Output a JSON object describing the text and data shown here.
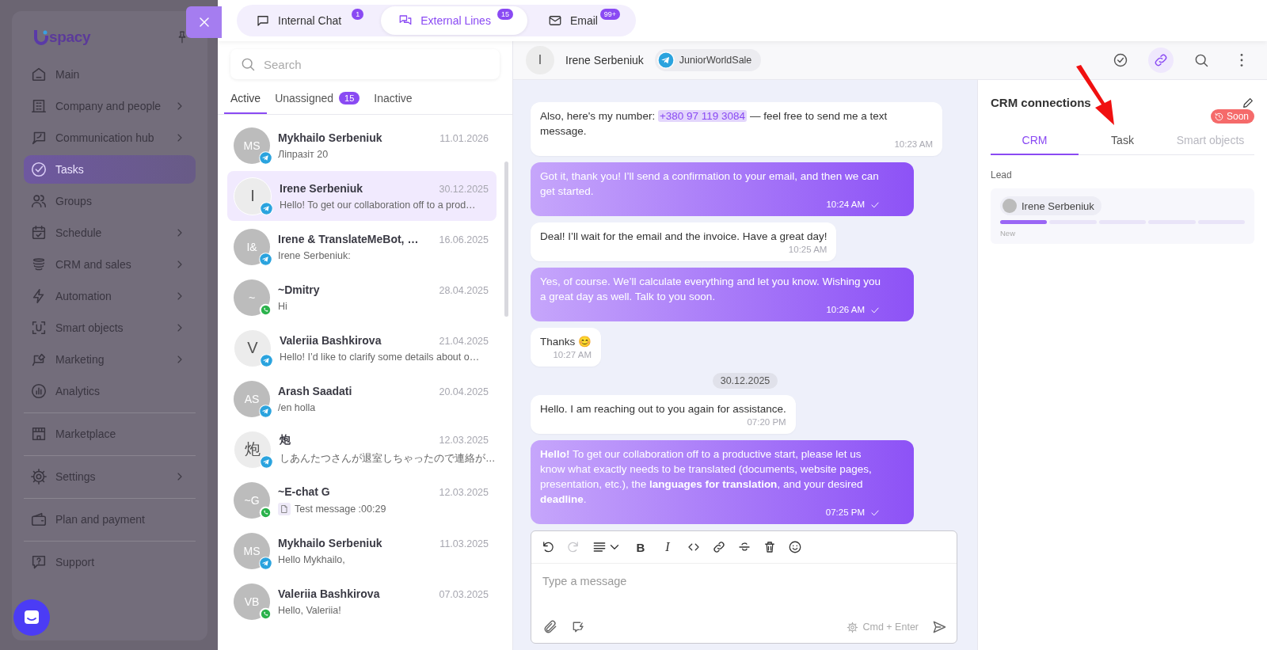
{
  "sidebar": {
    "logo": "spacy",
    "groups": [
      [
        {
          "label": "Main",
          "kind": "home",
          "selected": false,
          "submenu": false
        },
        {
          "label": "Company and people",
          "kind": "building",
          "selected": false,
          "submenu": true
        },
        {
          "label": "Communication hub",
          "kind": "hub",
          "selected": false,
          "submenu": true
        },
        {
          "label": "Tasks",
          "kind": "task",
          "selected": true,
          "submenu": false
        },
        {
          "label": "Groups",
          "kind": "users",
          "selected": false,
          "submenu": false
        },
        {
          "label": "Schedule",
          "kind": "calendar",
          "selected": false,
          "submenu": true
        },
        {
          "label": "CRM and sales",
          "kind": "stack",
          "selected": false,
          "submenu": true
        },
        {
          "label": "Automation",
          "kind": "bolt",
          "selected": false,
          "submenu": true
        },
        {
          "label": "Smart objects",
          "kind": "scan",
          "selected": false,
          "submenu": true
        },
        {
          "label": "Marketing",
          "kind": "marketing",
          "selected": false,
          "submenu": true
        },
        {
          "label": "Analytics",
          "kind": "chart",
          "selected": false,
          "submenu": false
        }
      ],
      [
        {
          "label": "Marketplace",
          "kind": "store",
          "selected": false,
          "submenu": false
        }
      ],
      [
        {
          "label": "Settings",
          "kind": "gear",
          "selected": false,
          "submenu": true
        }
      ],
      [
        {
          "label": "Plan and payment",
          "kind": "wallet",
          "selected": false,
          "submenu": false
        }
      ],
      [
        {
          "label": "Support",
          "kind": "help",
          "selected": false,
          "submenu": false
        }
      ]
    ]
  },
  "top_tabs": [
    {
      "label": "Internal Chat",
      "kind": "chat",
      "badge": "1",
      "selected": false
    },
    {
      "label": "External Lines",
      "kind": "lines",
      "badge": "15",
      "selected": true
    },
    {
      "label": "Email",
      "kind": "email",
      "badge": "99+",
      "selected": false
    }
  ],
  "chat_list": {
    "search": {
      "placeholder": "Search"
    },
    "filters": [
      {
        "label": "Active",
        "selected": true
      },
      {
        "label": "Unassigned",
        "badge": "15",
        "selected": false
      },
      {
        "label": "Inactive",
        "selected": false
      }
    ],
    "chats": [
      {
        "avatar": {
          "text": "MS",
          "kind": "filled"
        },
        "channel": {
          "kind": "telegram"
        },
        "name": "Mykhailo Serbeniuk",
        "date": "11.01.2026",
        "preview": "Ліпразіт 20",
        "attachment": false,
        "selected": false
      },
      {
        "avatar": {
          "text": "I",
          "kind": "outline"
        },
        "channel": {
          "kind": "telegram"
        },
        "name": "Irene Serbeniuk",
        "date": "30.12.2025",
        "preview": "Hello! To get our collaboration off to a prod…",
        "attachment": false,
        "selected": true
      },
      {
        "avatar": {
          "text": "I&",
          "kind": "filled"
        },
        "channel": {
          "kind": "telegram"
        },
        "name": "Irene & TranslateMeBot, …",
        "date": "16.06.2025",
        "preview": "Irene Serbeniuk:",
        "attachment": false,
        "selected": false
      },
      {
        "avatar": {
          "text": "~",
          "kind": "filled"
        },
        "channel": {
          "kind": "whatsapp"
        },
        "name": "~Dmitry",
        "date": "28.04.2025",
        "preview": "Hi",
        "attachment": false,
        "selected": false
      },
      {
        "avatar": {
          "text": "V",
          "kind": "outline"
        },
        "channel": {
          "kind": "telegram"
        },
        "name": "Valeriia Bashkirova",
        "date": "21.04.2025",
        "preview": "Hello! I’d like to clarify some details about o…",
        "attachment": false,
        "selected": false
      },
      {
        "avatar": {
          "text": "AS",
          "kind": "filled"
        },
        "channel": {
          "kind": "telegram"
        },
        "name": "Arash Saadati",
        "date": "20.04.2025",
        "preview": "/en holla",
        "attachment": false,
        "selected": false
      },
      {
        "avatar": {
          "text": "炮",
          "kind": "outline"
        },
        "channel": {
          "kind": "telegram"
        },
        "name": "炮",
        "date": "12.03.2025",
        "preview": "しあんたつさんが退室しちゃったので連絡が…",
        "attachment": false,
        "selected": false
      },
      {
        "avatar": {
          "text": "~G",
          "kind": "filled"
        },
        "channel": {
          "kind": "whatsapp"
        },
        "name": "~E-chat G",
        "date": "12.03.2025",
        "preview": "Test message :00:29",
        "attachment": true,
        "selected": false
      },
      {
        "avatar": {
          "text": "MS",
          "kind": "filled"
        },
        "channel": {
          "kind": "telegram"
        },
        "name": "Mykhailo Serbeniuk",
        "date": "11.03.2025",
        "preview": "Hello Mykhailo,",
        "attachment": false,
        "selected": false
      },
      {
        "avatar": {
          "text": "VB",
          "kind": "filled"
        },
        "channel": {
          "kind": "whatsapp"
        },
        "name": "Valeriia Bashkirova",
        "date": "07.03.2025",
        "preview": "Hello, Valeriia!",
        "attachment": false,
        "selected": false
      }
    ]
  },
  "chat": {
    "contact": {
      "initial": "I",
      "name": "Irene Serbeniuk",
      "channel": "JuniorWorldSale"
    },
    "actions": [
      {
        "kind": "complete",
        "active": false
      },
      {
        "kind": "link",
        "active": true
      },
      {
        "kind": "search",
        "active": false
      },
      {
        "kind": "more",
        "active": false
      }
    ],
    "messages": [
      {
        "kind": "incoming",
        "parts": [
          {
            "kind": "text",
            "text": "Also, here's my number: "
          },
          {
            "kind": "phone",
            "text": "+380 97 119 3084"
          },
          {
            "kind": "text",
            "text": " — feel free to send me a text message."
          }
        ],
        "time": "10:23 AM"
      },
      {
        "kind": "outgoing",
        "parts": [
          {
            "kind": "text",
            "text": "Got it, thank you! I’ll send a confirmation to your email, and then we can get started."
          }
        ],
        "time": "10:24 AM"
      },
      {
        "kind": "incoming",
        "parts": [
          {
            "kind": "text",
            "text": "Deal! I’ll wait for the email and the invoice. Have a great day!"
          }
        ],
        "time": "10:25 AM"
      },
      {
        "kind": "outgoing",
        "parts": [
          {
            "kind": "text",
            "text": "Yes, of course. We’ll calculate everything and let you know. Wishing you a great day as well. Talk to you soon."
          }
        ],
        "time": "10:26 AM"
      },
      {
        "kind": "incoming",
        "parts": [
          {
            "kind": "text",
            "text": "Thanks 😊"
          }
        ],
        "time": "10:27 AM"
      },
      {
        "kind": "date",
        "text": "30.12.2025"
      },
      {
        "kind": "incoming",
        "parts": [
          {
            "kind": "text",
            "text": "Hello. I am reaching out to you again for assistance."
          }
        ],
        "time": "07:20 PM"
      },
      {
        "kind": "outgoing",
        "parts": [
          {
            "kind": "text",
            "text": "**Hello!** To get our collaboration off to a productive start, please let us know what exactly needs to be translated (documents, website pages, presentation, etc.), the **languages for translation**, and your desired **deadline**."
          }
        ],
        "time": "07:25 PM"
      }
    ],
    "composer": {
      "tools": [
        {
          "kind": "undo",
          "disabled": false
        },
        {
          "kind": "redo",
          "disabled": true
        },
        {
          "kind": "align",
          "disabled": false
        },
        {
          "kind": "bold",
          "label": "B",
          "disabled": false
        },
        {
          "kind": "italic",
          "label": "I",
          "disabled": false
        },
        {
          "kind": "code",
          "disabled": false
        },
        {
          "kind": "link",
          "disabled": false
        },
        {
          "kind": "strike",
          "disabled": false
        },
        {
          "kind": "trash",
          "disabled": false
        },
        {
          "kind": "emoji",
          "disabled": false
        }
      ],
      "placeholder": "Type a message",
      "hint": "Cmd + Enter"
    }
  },
  "crm": {
    "title": "CRM connections",
    "tabs": [
      {
        "label": "CRM",
        "selected": true,
        "disabled": false
      },
      {
        "label": "Task",
        "selected": false,
        "disabled": false
      },
      {
        "label": "Smart objects",
        "selected": false,
        "disabled": true,
        "badge": "Soon"
      }
    ],
    "section": "Lead",
    "lead": {
      "name": "Irene Serbeniuk",
      "level": 0.2,
      "stage": "New"
    }
  }
}
